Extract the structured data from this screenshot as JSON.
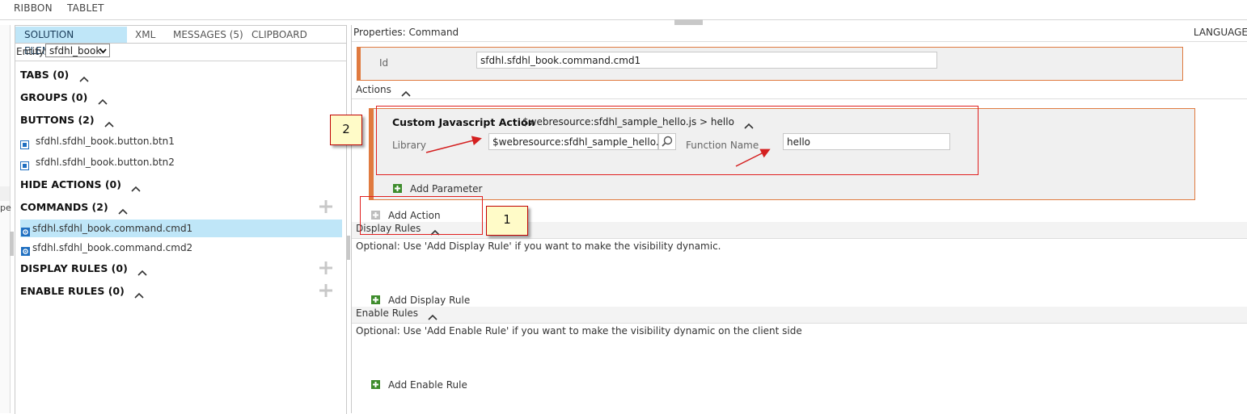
{
  "top_tabs": [
    "RIBBON",
    "TABLET"
  ],
  "left_strip_text": "pe",
  "left_panel": {
    "tabs": [
      {
        "label": "SOLUTION ELEMENTS",
        "active": true
      },
      {
        "label": "XML",
        "active": false
      },
      {
        "label": "MESSAGES (5)",
        "active": false
      },
      {
        "label": "CLIPBOARD",
        "active": false
      }
    ],
    "entity_label": "Entity:",
    "entity_value": "sfdhl_book",
    "sections": {
      "tabs": "TABS (0)",
      "groups": "GROUPS (0)",
      "buttons": "BUTTONS (2)",
      "hide_actions": "HIDE ACTIONS (0)",
      "commands": "COMMANDS (2)",
      "display_rules": "DISPLAY RULES (0)",
      "enable_rules": "ENABLE RULES (0)"
    },
    "buttons": [
      "sfdhl.sfdhl_book.button.btn1",
      "sfdhl.sfdhl_book.button.btn2"
    ],
    "commands": [
      "sfdhl.sfdhl_book.command.cmd1",
      "sfdhl.sfdhl_book.command.cmd2"
    ],
    "selected_command": "sfdhl.sfdhl_book.command.cmd1"
  },
  "right_panel": {
    "title": "Properties: Command",
    "language_label": "LANGUAGE",
    "id_label": "Id",
    "id_value": "sfdhl.sfdhl_book.command.cmd1",
    "actions_header": "Actions",
    "action": {
      "title": "Custom Javascript Action",
      "path": "$webresource:sfdhl_sample_hello.js > hello",
      "library_label": "Library",
      "library_value": "$webresource:sfdhl_sample_hello.js",
      "function_label": "Function Name",
      "function_value": "hello",
      "add_parameter": "Add Parameter"
    },
    "add_action": "Add Action",
    "display_rules_header": "Display Rules",
    "display_rules_hint": "Optional: Use 'Add Display Rule' if you want to make the visibility dynamic.",
    "add_display_rule": "Add Display Rule",
    "enable_rules_header": "Enable Rules",
    "enable_rules_hint": "Optional: Use 'Add Enable Rule' if you want to make the visibility dynamic on the client side",
    "add_enable_rule": "Add Enable Rule"
  },
  "annotations": {
    "callout_1": "1",
    "callout_2": "2"
  },
  "colors": {
    "accent_orange": "#e07a3f",
    "selection_blue": "#bfe6f8",
    "annotation_red": "#e02020",
    "callout_fill": "#fffbc8",
    "add_green": "#3e8c2c"
  }
}
